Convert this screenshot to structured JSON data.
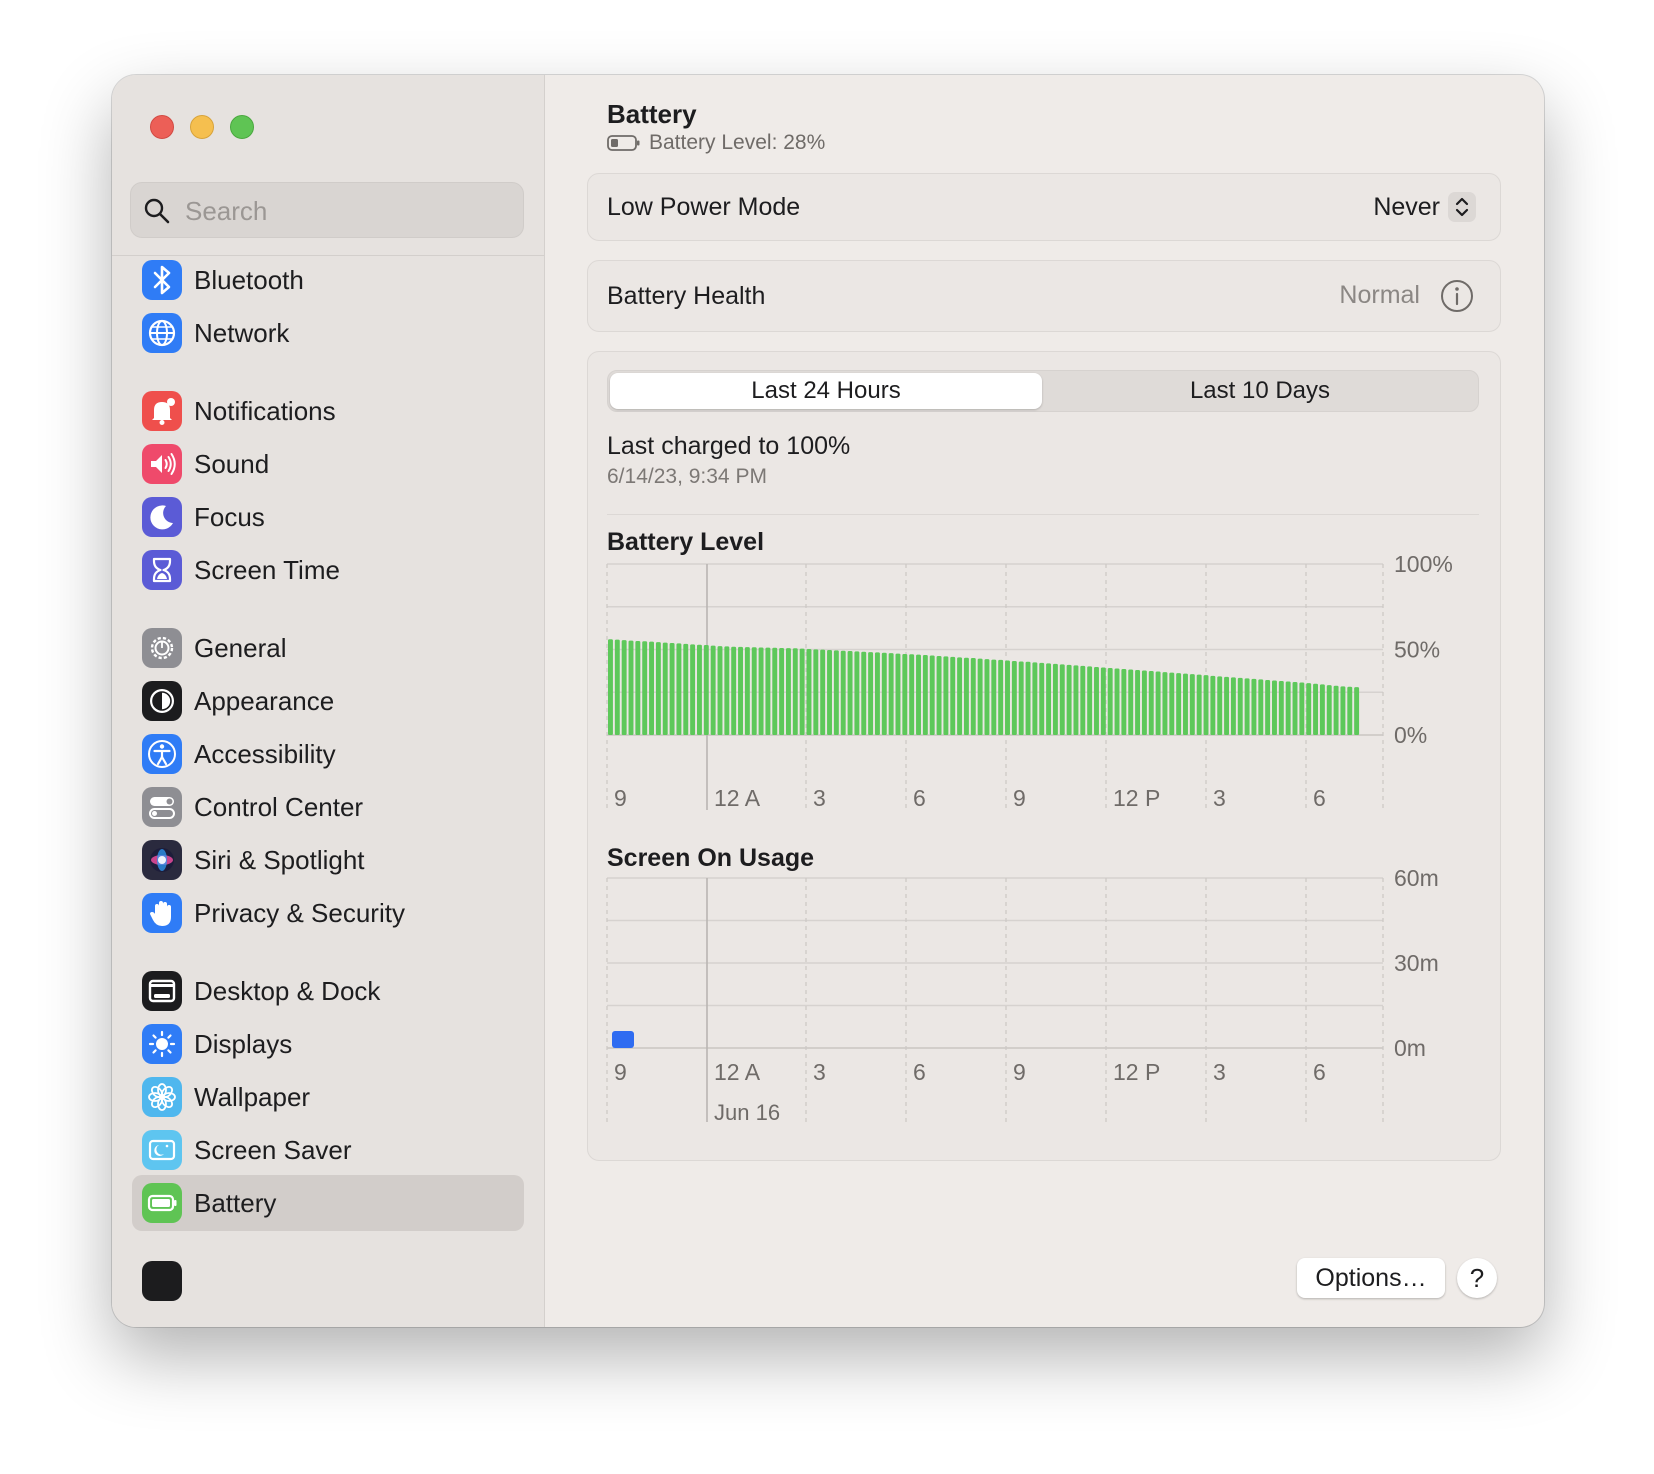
{
  "search": {
    "placeholder": "Search"
  },
  "sidebar": {
    "items": [
      {
        "label": "Bluetooth",
        "icon": "bluetooth-icon",
        "color": "#2f7cf6"
      },
      {
        "label": "Network",
        "icon": "globe-icon",
        "color": "#2f7cf6"
      },
      {
        "label": "Notifications",
        "icon": "bell-icon",
        "color": "#ef4f4c"
      },
      {
        "label": "Sound",
        "icon": "speaker-icon",
        "color": "#ef4a6b"
      },
      {
        "label": "Focus",
        "icon": "moon-icon",
        "color": "#5b5bd6"
      },
      {
        "label": "Screen Time",
        "icon": "hourglass-icon",
        "color": "#5b5bd6"
      },
      {
        "label": "General",
        "icon": "gear-icon",
        "color": "#8e8e93"
      },
      {
        "label": "Appearance",
        "icon": "appearance-icon",
        "color": "#1c1c1e"
      },
      {
        "label": "Accessibility",
        "icon": "accessibility-icon",
        "color": "#2f7cf6"
      },
      {
        "label": "Control Center",
        "icon": "toggles-icon",
        "color": "#8e8e93"
      },
      {
        "label": "Siri & Spotlight",
        "icon": "siri-icon",
        "color": "#2a2a3e"
      },
      {
        "label": "Privacy & Security",
        "icon": "hand-icon",
        "color": "#2f7cf6"
      },
      {
        "label": "Desktop & Dock",
        "icon": "dock-icon",
        "color": "#1c1c1e"
      },
      {
        "label": "Displays",
        "icon": "sun-icon",
        "color": "#2f7cf6"
      },
      {
        "label": "Wallpaper",
        "icon": "flower-icon",
        "color": "#4fb7ee"
      },
      {
        "label": "Screen Saver",
        "icon": "screensaver-icon",
        "color": "#5ec5f0"
      },
      {
        "label": "Battery",
        "icon": "battery-icon",
        "color": "#5fc454",
        "selected": true
      }
    ]
  },
  "header": {
    "title": "Battery",
    "subtitle": "Battery Level: 28%"
  },
  "low_power": {
    "label": "Low Power Mode",
    "value": "Never"
  },
  "health": {
    "label": "Battery Health",
    "value": "Normal"
  },
  "tabs": [
    {
      "label": "Last 24 Hours",
      "active": true
    },
    {
      "label": "Last 10 Days",
      "active": false
    }
  ],
  "charged": {
    "title": "Last charged to 100%",
    "date": "6/14/23, 9:34 PM"
  },
  "colors": {
    "battery_bar": "#5dc85a",
    "usage_bar": "#2f6cf1"
  },
  "chart_data": [
    {
      "type": "bar",
      "title": "Battery Level",
      "x_tick_labels": [
        "9",
        "12 A",
        "3",
        "6",
        "9",
        "12 P",
        "3",
        "6"
      ],
      "y_tick_labels": [
        "100%",
        "50%",
        "0%"
      ],
      "ylim": [
        0,
        100
      ],
      "values": [
        56,
        55.8,
        55.5,
        55.2,
        55,
        54.8,
        54.6,
        54.3,
        54,
        53.8,
        53.6,
        53.3,
        53,
        52.8,
        52.6,
        52.3,
        52,
        51.8,
        51.6,
        51.5,
        51.4,
        51.3,
        51.2,
        51.1,
        51,
        50.9,
        50.8,
        50.7,
        50.5,
        50.3,
        50.1,
        49.9,
        49.7,
        49.5,
        49.3,
        49.1,
        48.9,
        48.7,
        48.5,
        48.3,
        48.1,
        47.9,
        47.6,
        47.4,
        47.2,
        47,
        46.8,
        46.5,
        46.2,
        46,
        45.7,
        45.4,
        45.2,
        45,
        44.7,
        44.4,
        44.1,
        43.9,
        43.6,
        43.3,
        43,
        42.8,
        42.5,
        42.2,
        41.9,
        41.6,
        41.3,
        41,
        40.7,
        40.4,
        40.1,
        39.8,
        39.5,
        39.2,
        38.9,
        38.6,
        38.3,
        38,
        37.7,
        37.4,
        37.1,
        36.8,
        36.5,
        36.2,
        35.9,
        35.6,
        35.3,
        35,
        34.6,
        34.3,
        34,
        33.7,
        33.4,
        33.1,
        32.8,
        32.5,
        32.2,
        31.9,
        31.6,
        31.3,
        31,
        30.7,
        30.3,
        30,
        29.6,
        29.2,
        28.8,
        28.4,
        28.2,
        28
      ]
    },
    {
      "type": "bar",
      "title": "Screen On Usage",
      "x_tick_labels": [
        "9",
        "12 A",
        "3",
        "6",
        "9",
        "12 P",
        "3",
        "6"
      ],
      "x_sublabel": "Jun 16",
      "y_tick_labels": [
        "60m",
        "30m",
        "0m"
      ],
      "ylim": [
        0,
        60
      ],
      "values": [
        6
      ]
    }
  ]
}
